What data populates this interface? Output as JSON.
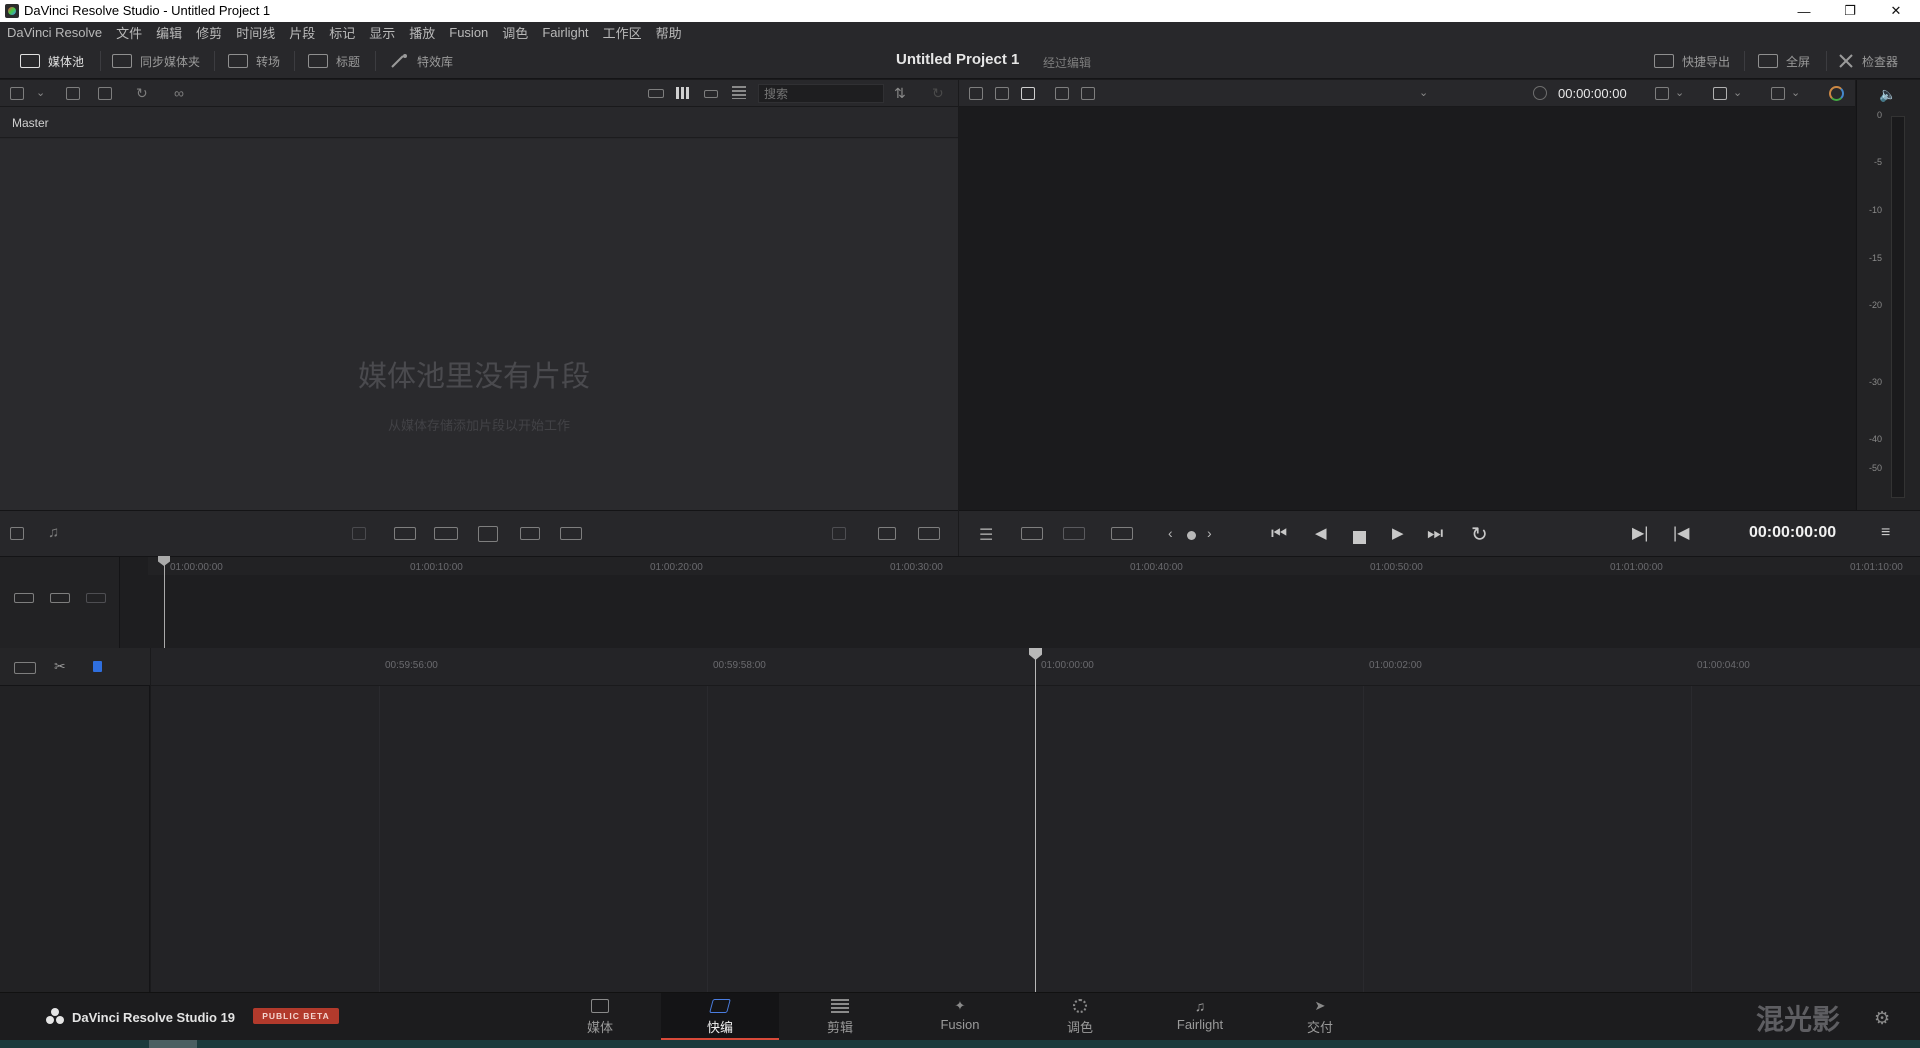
{
  "window": {
    "title": "DaVinci Resolve Studio - Untitled Project 1"
  },
  "menu": [
    "DaVinci Resolve",
    "文件",
    "编辑",
    "修剪",
    "时间线",
    "片段",
    "标记",
    "显示",
    "播放",
    "Fusion",
    "调色",
    "Fairlight",
    "工作区",
    "帮助"
  ],
  "toolbar": {
    "media_pool": "媒体池",
    "sync_bin": "同步媒体夹",
    "transitions": "转场",
    "titles": "标题",
    "effects": "特效库",
    "project_title": "Untitled Project 1",
    "project_sub": "经过编辑",
    "quick_export": "快捷导出",
    "fullscreen": "全屏",
    "inspector": "检查器"
  },
  "media_pool": {
    "search_placeholder": "搜索",
    "bin": "Master",
    "empty_title": "媒体池里没有片段",
    "empty_subtitle": "从媒体存储添加片段以开始工作"
  },
  "viewer": {
    "timecode": "00:00:00:00"
  },
  "audio_meter": {
    "labels": [
      "0",
      "-5",
      "-10",
      "-15",
      "-20",
      "-30",
      "-40",
      "-50"
    ]
  },
  "transport": {
    "timecode": "00:00:00:00"
  },
  "upper_timeline": {
    "ruler": [
      "01:00:00:00",
      "01:00:10:00",
      "01:00:20:00",
      "01:00:30:00",
      "01:00:40:00",
      "01:00:50:00",
      "01:01:00:00",
      "01:01:10:00"
    ]
  },
  "lower_timeline": {
    "ruler": [
      "00:59:56:00",
      "00:59:58:00",
      "01:00:00:00",
      "01:00:02:00",
      "01:00:04:00"
    ]
  },
  "pagebar": {
    "brand": "DaVinci Resolve Studio 19",
    "beta": "PUBLIC BETA",
    "pages": [
      "媒体",
      "快编",
      "剪辑",
      "Fusion",
      "调色",
      "Fairlight",
      "交付"
    ],
    "active_page": "快编",
    "watermark": "混光影"
  },
  "colors": {
    "accent": "#d84a3a",
    "beta_badge": "#b23a2c"
  }
}
